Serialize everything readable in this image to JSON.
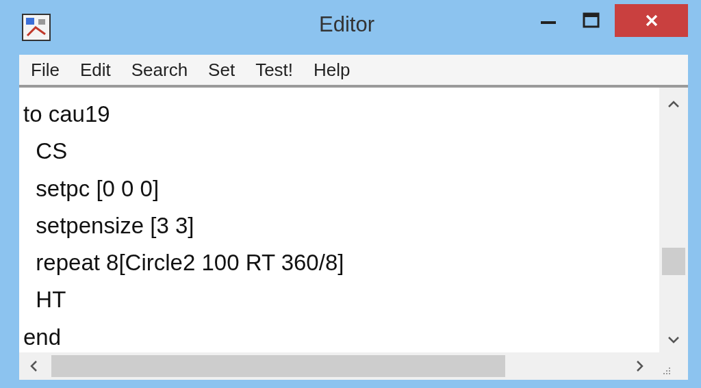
{
  "window": {
    "title": "Editor"
  },
  "menu": [
    "File",
    "Edit",
    "Search",
    "Set",
    "Test!",
    "Help"
  ],
  "code_lines": [
    "to cau19",
    "  CS",
    "  setpc [0 0 0]",
    "  setpensize [3 3]",
    "  repeat 8[Circle2 100 RT 360/8]",
    "  HT",
    "end"
  ]
}
